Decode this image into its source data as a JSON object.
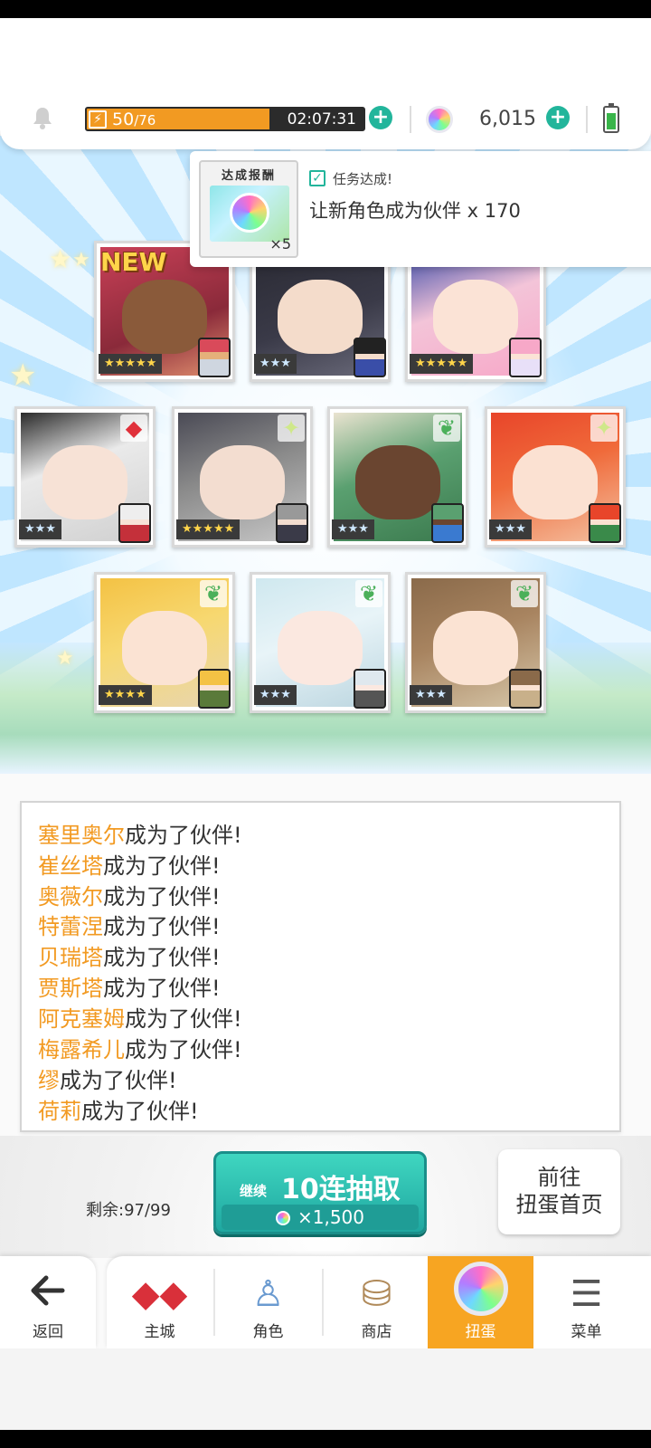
{
  "topbar": {
    "stamina_current": "50",
    "stamina_max": "/76",
    "stamina_fraction": 0.66,
    "stamina_timer": "02:07:31",
    "gem_count": "6,015"
  },
  "achievement": {
    "reward_title": "达成报酬",
    "reward_qty": "×5",
    "status": "任务达成!",
    "task": "让新角色成为伙伴  x 170"
  },
  "cards": {
    "new_label": "NEW",
    "c1_stars": "★★★★★",
    "c2_stars": "★★★",
    "c3_stars": "★★★★★",
    "c4_stars": "★★★",
    "c5_stars": "★★★★★",
    "c6_stars": "★★★",
    "c7_stars": "★★★",
    "c8_stars": "★★★★",
    "c9_stars": "★★★",
    "c10_stars": "★★★"
  },
  "log": {
    "suffix": "成为了伙伴!",
    "names": [
      "塞里奥尔",
      "崔丝塔",
      "奥薇尔",
      "特蕾涅",
      "贝瑞塔",
      "贾斯塔",
      "阿克塞姆",
      "梅露希儿",
      "缪",
      "荷莉"
    ]
  },
  "actions": {
    "remaining": "剩余:97/99",
    "pull_small": "继续",
    "pull_main": "10连抽取",
    "pull_cost": "×1,500",
    "home_line1": "前往",
    "home_line2": "扭蛋首页"
  },
  "nav": {
    "back": "返回",
    "tabs": [
      "主城",
      "角色",
      "商店",
      "扭蛋",
      "菜单"
    ]
  },
  "colors": {
    "accent_orange": "#f7a522",
    "teal": "#22b59b",
    "name_orange": "#f29a22"
  }
}
